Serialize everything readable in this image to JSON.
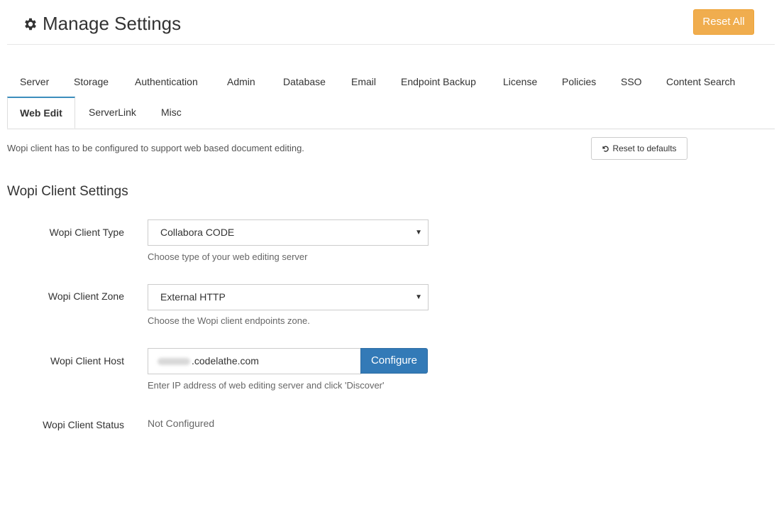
{
  "header": {
    "title": "Manage Settings",
    "title_icon": "gear-icon",
    "reset_all_label": "Reset All"
  },
  "tabs": {
    "row1": [
      "Server",
      "Storage",
      "Authentication",
      "Admin",
      "Database",
      "Email",
      "Endpoint Backup",
      "License",
      "Policies",
      "SSO",
      "Content Search"
    ],
    "row2": [
      "Web Edit",
      "ServerLink",
      "Misc"
    ],
    "active": "Web Edit"
  },
  "panel": {
    "description": "Wopi client has to be configured to support web based document editing.",
    "reset_defaults_label": "Reset to defaults",
    "section_title": "Wopi Client Settings"
  },
  "fields": {
    "client_type": {
      "label": "Wopi Client Type",
      "value": "Collabora CODE",
      "help": "Choose type of your web editing server"
    },
    "client_zone": {
      "label": "Wopi Client Zone",
      "value": "External HTTP",
      "help": "Choose the Wopi client endpoints zone."
    },
    "client_host": {
      "label": "Wopi Client Host",
      "value_visible": ".codelathe.com",
      "button_label": "Configure",
      "help": "Enter IP address of web editing server and click 'Discover'"
    },
    "client_status": {
      "label": "Wopi Client Status",
      "value": "Not Configured"
    }
  },
  "colors": {
    "reset_all_bg": "#f0ad4e",
    "configure_bg": "#337ab7",
    "active_tab_border": "#3c8dbc"
  }
}
